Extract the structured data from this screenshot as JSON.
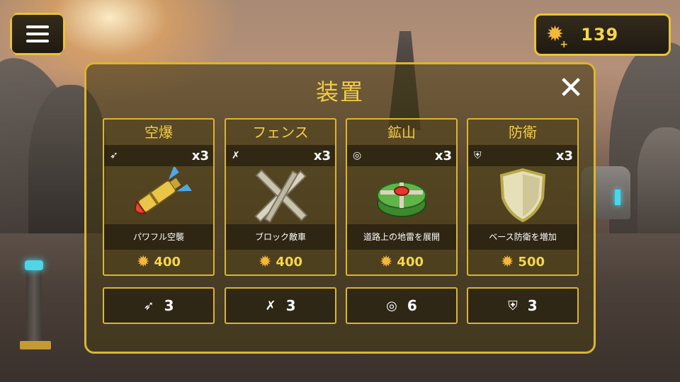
{
  "hud": {
    "menu_icon": "hamburger-menu-icon",
    "coins": "139",
    "coin_icon": "gear-coin-plus-icon"
  },
  "panel": {
    "title": "装置",
    "close_icon": "close-icon"
  },
  "cards": [
    {
      "name": "空爆",
      "icon": "missile-icon",
      "count": "x3",
      "description": "パワフル空襲",
      "price": "400"
    },
    {
      "name": "フェンス",
      "icon": "barricade-icon",
      "count": "x3",
      "description": "ブロック敵車",
      "price": "400"
    },
    {
      "name": "鉱山",
      "icon": "mine-icon",
      "count": "x3",
      "description": "道路上の地雷を展開",
      "price": "400"
    },
    {
      "name": "防衛",
      "icon": "shield-icon",
      "count": "x3",
      "description": "ベース防衛を増加",
      "price": "500"
    }
  ],
  "slots": [
    {
      "icon": "missile-icon",
      "value": "3"
    },
    {
      "icon": "barricade-icon",
      "value": "3"
    },
    {
      "icon": "mine-icon",
      "value": "6"
    },
    {
      "icon": "shield-icon",
      "value": "3"
    }
  ],
  "colors": {
    "accent_gold": "#d9b531",
    "title_gold": "#f1cd4a",
    "price_gold": "#f5d64a",
    "gear_orange": "#f3b73a"
  }
}
